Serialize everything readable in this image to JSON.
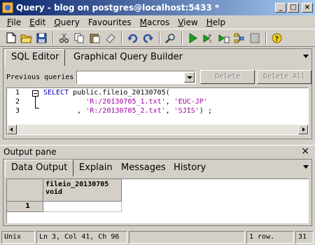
{
  "window": {
    "title": "Query - blog on postgres@localhost:5433 *",
    "min_glyph": "_",
    "max_glyph": "□",
    "close_glyph": "×"
  },
  "menu": [
    {
      "label": "File",
      "u": "F",
      "rest": "ile"
    },
    {
      "label": "Edit",
      "u": "E",
      "rest": "dit"
    },
    {
      "label": "Query",
      "u": "Q",
      "rest": "uery"
    },
    {
      "label": "Favourites",
      "u": "",
      "rest": "Favourites"
    },
    {
      "label": "Macros",
      "u": "M",
      "rest": "acros"
    },
    {
      "label": "View",
      "u": "V",
      "rest": "iew"
    },
    {
      "label": "Help",
      "u": "H",
      "rest": "elp"
    }
  ],
  "editor_tabs": {
    "sql_editor": "SQL Editor",
    "graphical_builder": "Graphical Query Builder"
  },
  "previous_queries": {
    "label": "Previous queries",
    "value": "",
    "delete_label": "Delete",
    "delete_all_label": "Delete All"
  },
  "editor": {
    "line_numbers": [
      "1",
      "2",
      "3"
    ],
    "line1": {
      "keyword": "SELECT",
      "rest": " public.fileio_20130705("
    },
    "line2": {
      "indent": "          ",
      "s1": "'R:/20130705_1.txt'",
      "sep": ", ",
      "s2": "'EUC-JP'"
    },
    "line3": {
      "indent": "        , ",
      "s1": "'R:/20130705_2.txt'",
      "sep": ", ",
      "s2": "'SJIS'",
      "tail": ") ;"
    }
  },
  "output": {
    "pane_label": "Output pane",
    "close_glyph": "×",
    "tabs": {
      "data_output": "Data Output",
      "explain": "Explain",
      "messages": "Messages",
      "history": "History"
    },
    "grid": {
      "column_name": "fileio_20130705",
      "column_type": "void",
      "rows": [
        {
          "num": "1",
          "value": ""
        }
      ]
    }
  },
  "status": {
    "encoding": "Unix",
    "position": "Ln 3, Col 41, Ch 96",
    "message": "",
    "rows": "1 row.",
    "time": "31"
  },
  "colors": {
    "title_start": "#0a246a",
    "title_end": "#a6caf0",
    "keyword": "#0000c0",
    "string": "#a000a0",
    "chrome": "#d4d0c8"
  }
}
